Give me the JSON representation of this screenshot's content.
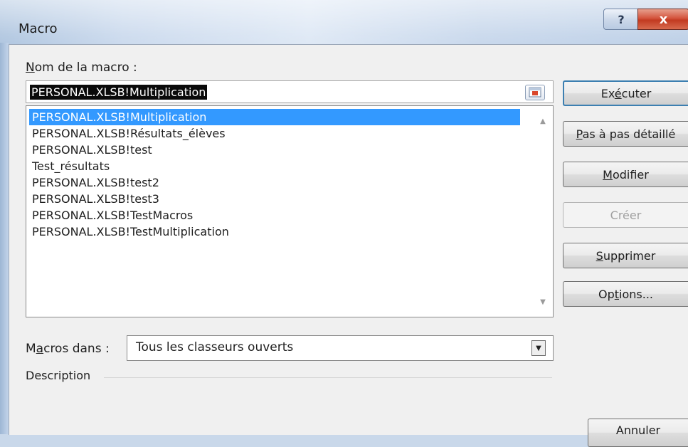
{
  "window": {
    "title": "Macro",
    "help_glyph": "?",
    "close_glyph": "x"
  },
  "name_field": {
    "label_prefix": "",
    "label_mnemonic": "N",
    "label_rest": "om de la macro :",
    "value": "PERSONAL.XLSB!Multiplication"
  },
  "macro_list": {
    "items": [
      "PERSONAL.XLSB!Multiplication",
      "PERSONAL.XLSB!Résultats_élèves",
      "PERSONAL.XLSB!test",
      "Test_résultats",
      "PERSONAL.XLSB!test2",
      "PERSONAL.XLSB!test3",
      "PERSONAL.XLSB!TestMacros",
      "PERSONAL.XLSB!TestMultiplication"
    ],
    "selected_index": 0
  },
  "buttons": {
    "execute": {
      "pre": "Ex",
      "mn": "é",
      "post": "cuter"
    },
    "step": {
      "pre": "",
      "mn": "P",
      "post": "as à pas détaillé"
    },
    "edit": {
      "pre": "",
      "mn": "M",
      "post": "odifier"
    },
    "create": {
      "pre": "",
      "mn": "",
      "post": "Créer"
    },
    "delete": {
      "pre": "",
      "mn": "S",
      "post": "upprimer"
    },
    "options": {
      "pre": "Op",
      "mn": "t",
      "post": "ions..."
    },
    "cancel": {
      "pre": "",
      "mn": "",
      "post": "Annuler"
    }
  },
  "macros_in": {
    "label_pre": "M",
    "label_mn": "a",
    "label_post": "cros dans :",
    "value": "Tous les classeurs ouverts"
  },
  "description": {
    "label": "Description"
  },
  "colors": {
    "selection": "#3399ff",
    "close_red": "#c23a21"
  }
}
